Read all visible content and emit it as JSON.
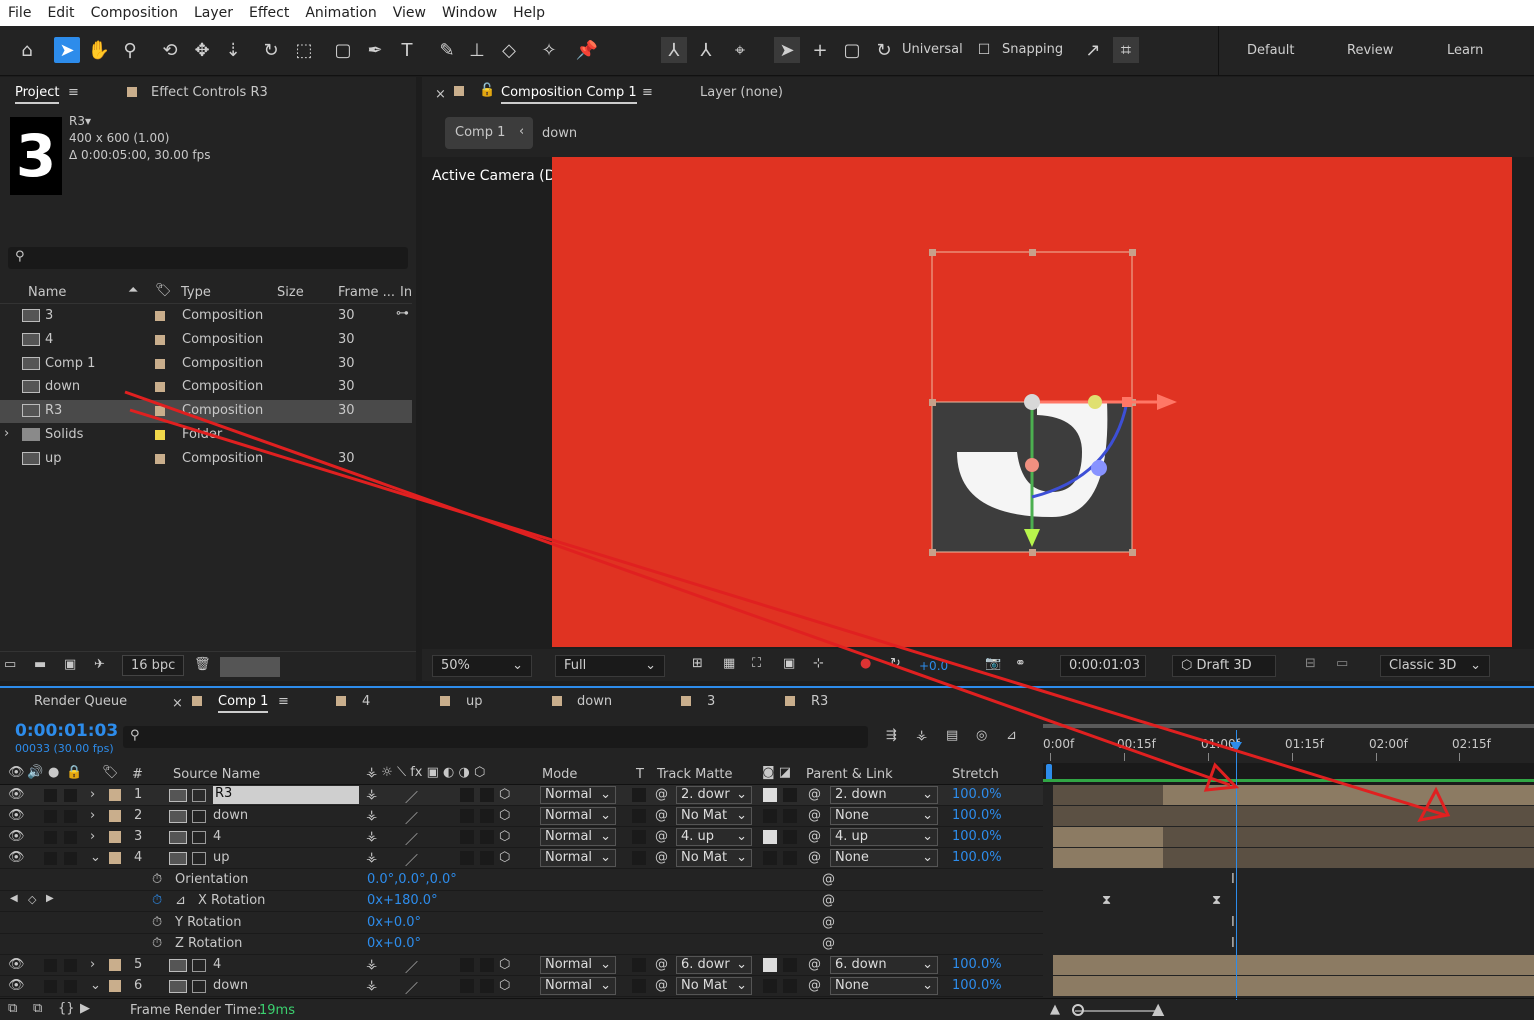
{
  "menu": [
    "File",
    "Edit",
    "Composition",
    "Layer",
    "Effect",
    "Animation",
    "View",
    "Window",
    "Help"
  ],
  "toolbar": {
    "universal_label": "Universal",
    "snapping_label": "Snapping",
    "workspaces": [
      "Default",
      "Review",
      "Learn"
    ]
  },
  "project_panel": {
    "tab_project": "Project",
    "tab_effect_controls": "Effect Controls R3",
    "thumb_text": "3",
    "selected_name": "R3▾",
    "selected_info1": "400 x 600 (1.00)",
    "selected_info2": "Δ 0:00:05:00, 30.00 fps",
    "search_placeholder": "",
    "columns": {
      "name": "Name",
      "type": "Type",
      "size": "Size",
      "frame": "Frame ...",
      "in": "In"
    },
    "items": [
      {
        "name": "3",
        "type": "Composition",
        "frame": "30",
        "color": "#c9ae8c"
      },
      {
        "name": "4",
        "type": "Composition",
        "frame": "30",
        "color": "#c9ae8c"
      },
      {
        "name": "Comp 1",
        "type": "Composition",
        "frame": "30",
        "color": "#c9ae8c"
      },
      {
        "name": "down",
        "type": "Composition",
        "frame": "30",
        "color": "#c9ae8c"
      },
      {
        "name": "R3",
        "type": "Composition",
        "frame": "30",
        "color": "#c9ae8c"
      },
      {
        "name": "Solids",
        "type": "Folder",
        "frame": "",
        "color": "#f1d84a"
      },
      {
        "name": "up",
        "type": "Composition",
        "frame": "30",
        "color": "#c9ae8c"
      }
    ],
    "bpc": "16 bpc"
  },
  "composition_panel": {
    "tab_comp": "Composition Comp 1",
    "tab_layer": "Layer (none)",
    "breadcrumb_comp": "Comp 1",
    "breadcrumb_child": "down",
    "camera_label": "Active Camera (Default)",
    "zoom": "50%",
    "resolution": "Full",
    "exposure": "+0.0",
    "timecode": "0:00:01:03",
    "renderer_draft": "Draft 3D",
    "renderer": "Classic 3D",
    "bg_color": "#e03322"
  },
  "timeline_tabs": [
    "Render Queue",
    "Comp 1",
    "4",
    "up",
    "down",
    "3",
    "R3"
  ],
  "timeline": {
    "current_time": "0:00:01:03",
    "frame_info": "00033 (30.00 fps)",
    "columns": {
      "num": "#",
      "source": "Source Name",
      "mode": "Mode",
      "t": "T",
      "track_matte": "Track Matte",
      "parent": "Parent & Link",
      "stretch": "Stretch"
    },
    "ruler": [
      "0:00f",
      "00:15f",
      "01:00f",
      "01:15f",
      "02:00f",
      "02:15f"
    ],
    "layers": [
      {
        "num": "1",
        "name": "R3",
        "mode": "Normal",
        "matte": "2. dowr",
        "parent": "2. down",
        "stretch": "100.0%"
      },
      {
        "num": "2",
        "name": "down",
        "mode": "Normal",
        "matte": "No Mat",
        "parent": "None",
        "stretch": "100.0%"
      },
      {
        "num": "3",
        "name": "4",
        "mode": "Normal",
        "matte": "4. up",
        "parent": "4. up",
        "stretch": "100.0%"
      },
      {
        "num": "4",
        "name": "up",
        "mode": "Normal",
        "matte": "No Mat",
        "parent": "None",
        "stretch": "100.0%"
      }
    ],
    "properties": [
      {
        "name": "Orientation",
        "value": "0.0°,0.0°,0.0°"
      },
      {
        "name": "X Rotation",
        "value": "0x+180.0°"
      },
      {
        "name": "Y Rotation",
        "value": "0x+0.0°"
      },
      {
        "name": "Z Rotation",
        "value": "0x+0.0°"
      }
    ],
    "layers2": [
      {
        "num": "5",
        "name": "4",
        "mode": "Normal",
        "matte": "6. dowr",
        "parent": "6. down",
        "stretch": "100.0%"
      },
      {
        "num": "6",
        "name": "down",
        "mode": "Normal",
        "matte": "No Mat",
        "parent": "None",
        "stretch": "100.0%"
      }
    ],
    "frame_render_label": "Frame Render Time:",
    "frame_render_value": "19ms"
  }
}
